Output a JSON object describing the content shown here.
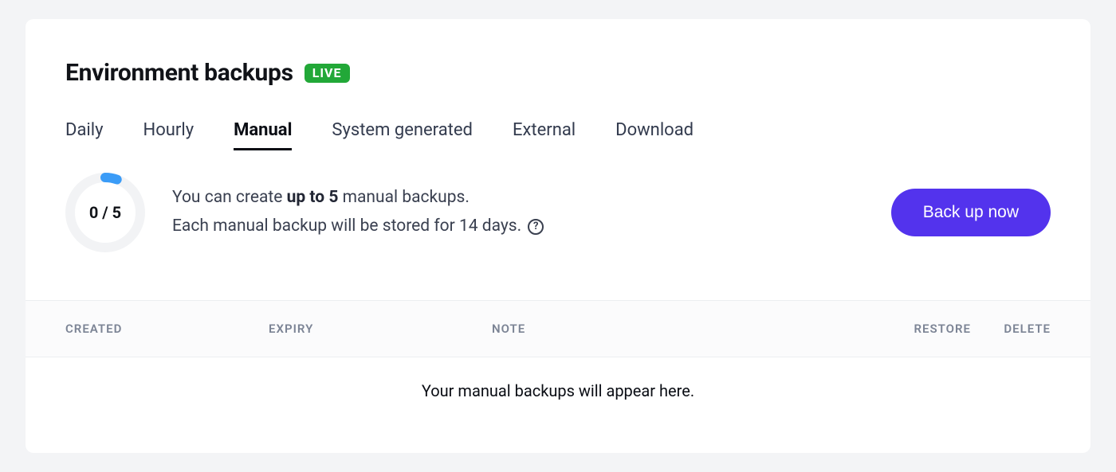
{
  "header": {
    "title": "Environment backups",
    "badge": "LIVE"
  },
  "tabs": [
    {
      "label": "Daily",
      "active": false
    },
    {
      "label": "Hourly",
      "active": false
    },
    {
      "label": "Manual",
      "active": true
    },
    {
      "label": "System generated",
      "active": false
    },
    {
      "label": "External",
      "active": false
    },
    {
      "label": "Download",
      "active": false
    }
  ],
  "info": {
    "used": 0,
    "total": 5,
    "counter": "0 / 5",
    "line1_pre": "You can create ",
    "line1_bold": "up to 5",
    "line1_post": " manual backups.",
    "line2": "Each manual backup will be stored for 14 days."
  },
  "actions": {
    "backup_now": "Back up now"
  },
  "table": {
    "columns": {
      "created": "CREATED",
      "expiry": "EXPIRY",
      "note": "NOTE",
      "restore": "RESTORE",
      "delete": "DELETE"
    },
    "empty": "Your manual backups will appear here."
  }
}
